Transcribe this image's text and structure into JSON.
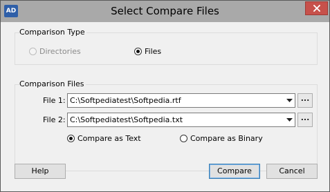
{
  "window": {
    "title": "Select Compare Files",
    "app_icon_text": "AD"
  },
  "comparison_type": {
    "label": "Comparison Type",
    "options": [
      {
        "label": "Directories",
        "checked": false,
        "enabled": false
      },
      {
        "label": "Files",
        "checked": true,
        "enabled": true
      }
    ]
  },
  "comparison_files": {
    "label": "Comparison Files",
    "file1_label": "File 1:",
    "file1_value": "C:\\Softpediatest\\Softpedia.rtf",
    "file2_label": "File 2:",
    "file2_value": "C:\\Softpediatest\\Softpedia.txt",
    "browse_label": "...",
    "modes": [
      {
        "label": "Compare as Text",
        "checked": true
      },
      {
        "label": "Compare as Binary",
        "checked": false
      }
    ]
  },
  "buttons": {
    "help": "Help",
    "compare": "Compare",
    "cancel": "Cancel"
  },
  "icons": {
    "app": "app-icon",
    "close": "close-icon",
    "dropdown": "chevron-down-icon"
  }
}
